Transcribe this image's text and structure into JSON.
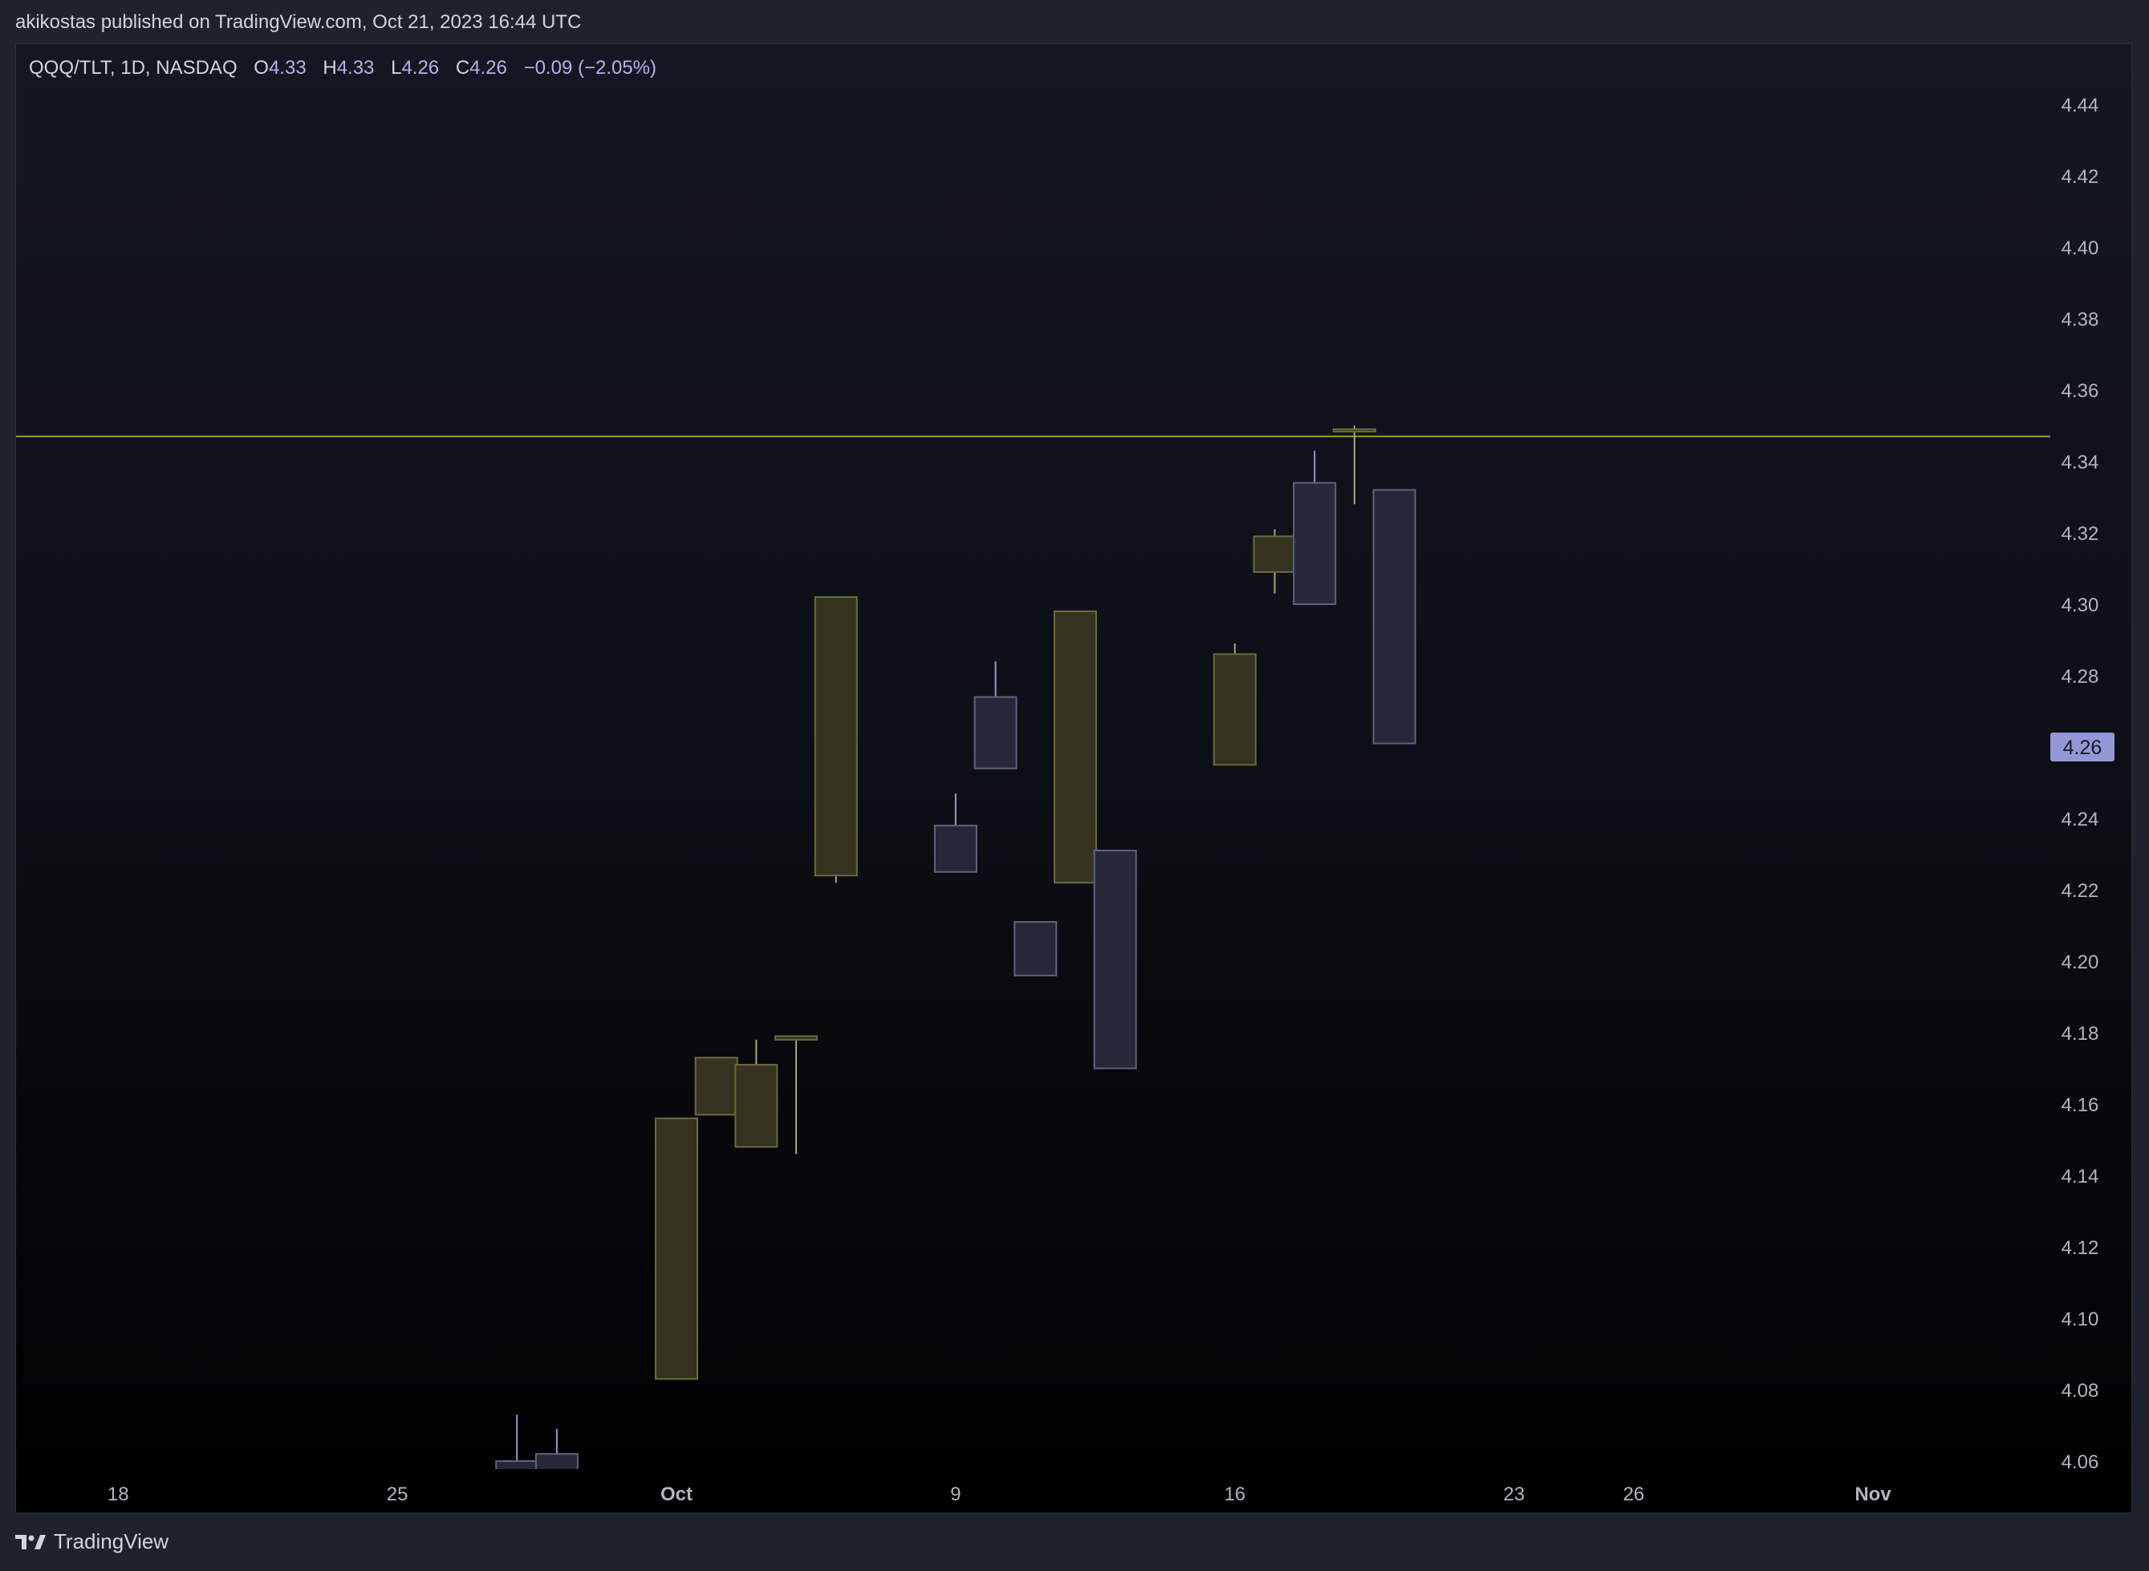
{
  "header": {
    "published_text": "akikostas published on TradingView.com, Oct 21, 2023 16:44 UTC"
  },
  "legend": {
    "symbol": "QQQ/TLT, 1D, NASDAQ",
    "open_label": "O",
    "open": "4.33",
    "high_label": "H",
    "high": "4.33",
    "low_label": "L",
    "low": "4.26",
    "close_label": "C",
    "close": "4.26",
    "change": "−0.09 (−2.05%)"
  },
  "footer": {
    "brand": "TradingView"
  },
  "colors": {
    "up_body": "#34331f",
    "up_border": "#6b6a3c",
    "down_body": "#252838",
    "down_border": "#5e637e",
    "down_wick": "#9398cc",
    "up_wick": "#aaa77a",
    "hline": "#9d9a2c",
    "axis_text": "#b2b5be",
    "price_badge_bg": "#9497d6",
    "price_badge_text": "#131722"
  },
  "chart_data": {
    "type": "candlestick",
    "symbol": "QQQ/TLT",
    "interval": "1D",
    "exchange": "NASDAQ",
    "y_ticks": [
      "4.06",
      "4.08",
      "4.10",
      "4.12",
      "4.14",
      "4.16",
      "4.18",
      "4.20",
      "4.22",
      "4.24",
      "4.26",
      "4.28",
      "4.30",
      "4.32",
      "4.34",
      "4.36",
      "4.38",
      "4.40",
      "4.42",
      "4.44"
    ],
    "ylim": [
      4.06,
      4.45
    ],
    "x_ticks": [
      {
        "label": "18",
        "date": "2023-09-18",
        "bold": false
      },
      {
        "label": "25",
        "date": "2023-09-25",
        "bold": false
      },
      {
        "label": "Oct",
        "date": "2023-10-02",
        "bold": true
      },
      {
        "label": "9",
        "date": "2023-10-09",
        "bold": false
      },
      {
        "label": "16",
        "date": "2023-10-16",
        "bold": false
      },
      {
        "label": "23",
        "date": "2023-10-23",
        "bold": false
      },
      {
        "label": "26",
        "date": "2023-10-26",
        "bold": false
      },
      {
        "label": "Nov",
        "date": "2023-11-01",
        "bold": true
      }
    ],
    "candles": [
      {
        "date": "2023-09-28",
        "open": 4.06,
        "high": 4.073,
        "low": 4.05,
        "close": 4.045
      },
      {
        "date": "2023-09-29",
        "open": 4.062,
        "high": 4.069,
        "low": 4.05,
        "close": 4.05
      },
      {
        "date": "2023-10-02",
        "open": 4.083,
        "high": 4.156,
        "low": 4.083,
        "close": 4.156
      },
      {
        "date": "2023-10-03",
        "open": 4.157,
        "high": 4.173,
        "low": 4.157,
        "close": 4.173
      },
      {
        "date": "2023-10-04",
        "open": 4.148,
        "high": 4.178,
        "low": 4.148,
        "close": 4.171
      },
      {
        "date": "2023-10-05",
        "open": 4.178,
        "high": 4.179,
        "low": 4.146,
        "close": 4.179
      },
      {
        "date": "2023-10-06",
        "open": 4.224,
        "high": 4.302,
        "low": 4.222,
        "close": 4.302
      },
      {
        "date": "2023-10-09",
        "open": 4.238,
        "high": 4.247,
        "low": 4.225,
        "close": 4.225
      },
      {
        "date": "2023-10-10",
        "open": 4.274,
        "high": 4.284,
        "low": 4.254,
        "close": 4.254
      },
      {
        "date": "2023-10-11",
        "open": 4.211,
        "high": 4.211,
        "low": 4.196,
        "close": 4.196
      },
      {
        "date": "2023-10-12",
        "open": 4.222,
        "high": 4.298,
        "low": 4.222,
        "close": 4.298
      },
      {
        "date": "2023-10-13",
        "open": 4.231,
        "high": 4.231,
        "low": 4.17,
        "close": 4.17
      },
      {
        "date": "2023-10-16",
        "open": 4.255,
        "high": 4.289,
        "low": 4.255,
        "close": 4.286
      },
      {
        "date": "2023-10-17",
        "open": 4.309,
        "high": 4.321,
        "low": 4.303,
        "close": 4.319
      },
      {
        "date": "2023-10-18",
        "open": 4.334,
        "high": 4.343,
        "low": 4.3,
        "close": 4.3
      },
      {
        "date": "2023-10-19",
        "open": 4.349,
        "high": 4.35,
        "low": 4.328,
        "close": 4.349
      },
      {
        "date": "2023-10-20",
        "open": 4.332,
        "high": 4.332,
        "low": 4.261,
        "close": 4.261
      }
    ],
    "horizontal_line": 4.347,
    "last_price": "4.26"
  }
}
